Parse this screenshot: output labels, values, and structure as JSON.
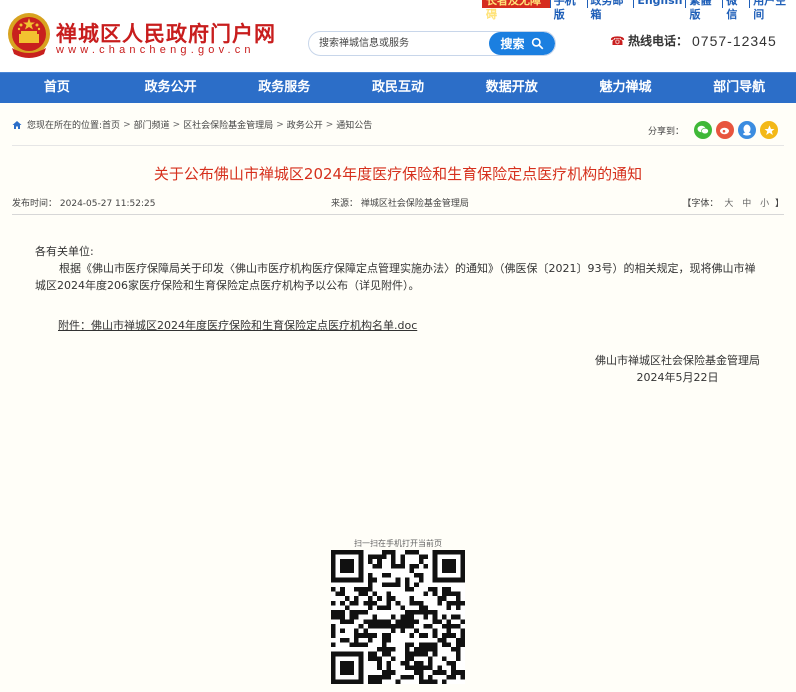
{
  "header": {
    "site_title": "禅城区人民政府门户网",
    "site_domain": "www.chancheng.gov.cn",
    "toplinks": [
      "长者及无障碍",
      "手机版",
      "政务邮箱",
      "English",
      "繁體版",
      "微信",
      "用户空间"
    ],
    "search": {
      "placeholder": "搜索禅城信息或服务",
      "button_label": "搜索"
    },
    "hotline": {
      "label": "热线电话：",
      "number": "0757-12345"
    }
  },
  "nav": [
    "首页",
    "政务公开",
    "政务服务",
    "政民互动",
    "数据开放",
    "魅力禅城",
    "部门导航"
  ],
  "breadcrumb": {
    "prefix": "您现在所在的位置:",
    "items": [
      "首页",
      "部门频道",
      "区社会保险基金管理局",
      "政务公开",
      "通知公告"
    ],
    "separator": ">"
  },
  "share": {
    "label": "分享到：",
    "icons": [
      "wechat-icon",
      "weibo-icon",
      "qq-icon",
      "qzone-icon"
    ]
  },
  "article": {
    "title": "关于公布佛山市禅城区2024年度医疗保险和生育保险定点医疗机构的通知",
    "publish_label": "发布时间：",
    "publish_time": "2024-05-27 11:52:25",
    "source_label": "来源：",
    "source": "禅城区社会保险基金管理局",
    "font_label": "【字体：",
    "font_sizes": [
      "大",
      "中",
      "小"
    ],
    "font_close": "】",
    "greeting": "各有关单位:",
    "paragraph": "根据《佛山市医疗保障局关于印发〈佛山市医疗机构医疗保障定点管理实施办法〉的通知》（佛医保〔2021〕93号）的相关规定，现将佛山市禅城区2024年度206家医疗保险和生育保险定点医疗机构予以公布（详见附件）。",
    "attachment": "附件：佛山市禅城区2024年度医疗保险和生育保险定点医疗机构名单.doc",
    "signature": "佛山市禅城区社会保险基金管理局",
    "date": "2024年5月22日"
  },
  "qr": {
    "label": "扫一扫在手机打开当前页"
  },
  "colors": {
    "nav_bg": "#2c6ec8",
    "title_red": "#d6301d",
    "search_blue": "#1b7fe0"
  }
}
